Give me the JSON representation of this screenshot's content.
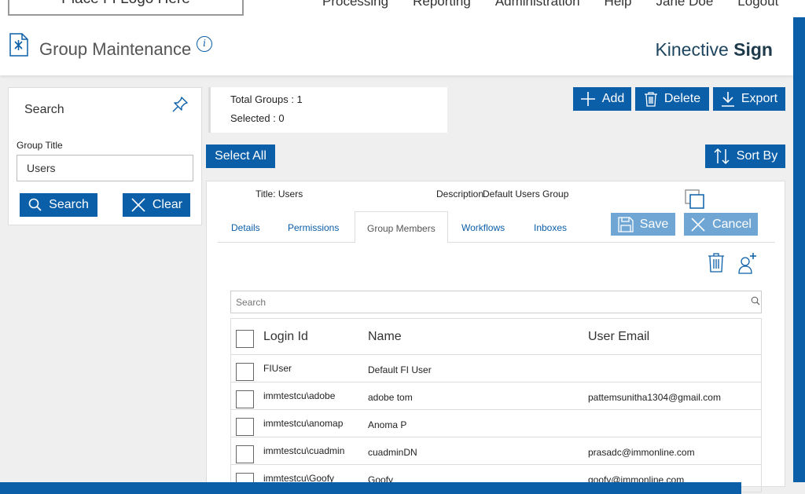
{
  "nav": {
    "logo_text": "Place FI Logo Here",
    "items": [
      "Processing",
      "Reporting",
      "Administration",
      "Help",
      "Jane Doe",
      "Logout"
    ]
  },
  "header": {
    "title": "Group Maintenance",
    "info_glyph": "i",
    "brand_light": "Kinective",
    "brand_bold": "Sign"
  },
  "search_panel": {
    "title": "Search",
    "field_label": "Group Title",
    "field_value": "Users",
    "search_label": "Search",
    "clear_label": "Clear"
  },
  "counts": {
    "total": "Total Groups : 1",
    "selected": "Selected : 0"
  },
  "toolbar": {
    "add_label": "Add",
    "delete_label": "Delete",
    "export_label": "Export",
    "select_all_label": "Select All",
    "sort_by_label": "Sort By"
  },
  "group": {
    "title_text": "Title: Users",
    "description_label": "Description",
    "description_value": "Default Users Group"
  },
  "tabs": [
    {
      "label": "Details"
    },
    {
      "label": "Permissions"
    },
    {
      "label": "Group Members"
    },
    {
      "label": "Workflows"
    },
    {
      "label": "Inboxes"
    }
  ],
  "active_tab": "Group Members",
  "edit_actions": {
    "save_label": "Save",
    "cancel_label": "Cancel"
  },
  "members": {
    "search_placeholder": "Search",
    "columns": [
      "Login Id",
      "Name",
      "User Email"
    ],
    "rows": [
      {
        "login": "FIUser",
        "name": "Default FI User",
        "email": ""
      },
      {
        "login": "immtestcu\\adobe",
        "name": "adobe tom",
        "email": "pattemsunitha1304@gmail.com"
      },
      {
        "login": "immtestcu\\anomap",
        "name": "Anoma P",
        "email": ""
      },
      {
        "login": "immtestcu\\cuadmin",
        "name": "cuadminDN",
        "email": "prasadc@immonline.com"
      },
      {
        "login": "immtestcu\\Goofy",
        "name": "Goofy",
        "email": "goofy@immonline.com"
      }
    ]
  },
  "colors": {
    "primary": "#0b5ea8",
    "primary_light": "#6fa6d4",
    "brand_text": "#1e4660"
  },
  "icons": [
    "document-icon",
    "info-icon",
    "pin-icon",
    "search-icon",
    "close-icon",
    "plus-icon",
    "trash-icon",
    "download-icon",
    "sort-icon",
    "save-icon",
    "copy-icon",
    "add-user-icon"
  ]
}
